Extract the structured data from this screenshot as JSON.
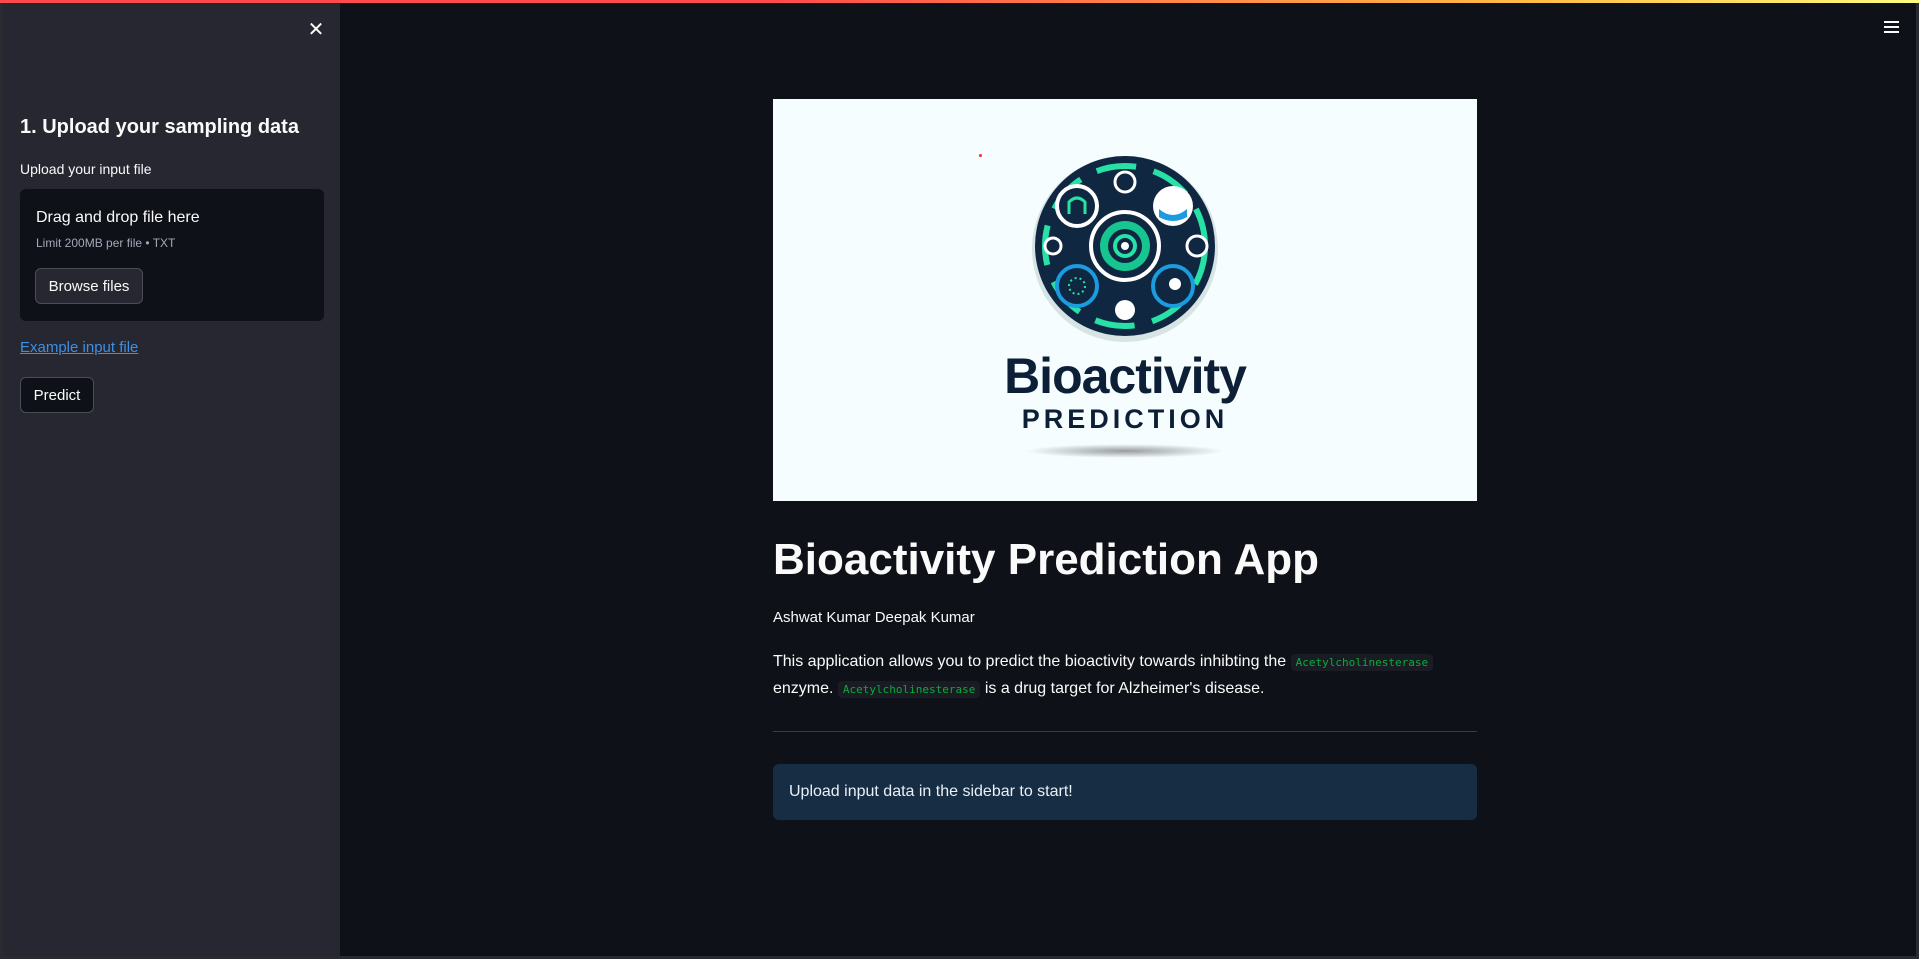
{
  "sidebar": {
    "heading": "1. Upload your sampling data",
    "upload_label": "Upload your input file",
    "dropzone": {
      "title": "Drag and drop file here",
      "limit": "Limit 200MB per file • TXT",
      "browse_label": "Browse files"
    },
    "example_link": "Example input file",
    "predict_label": "Predict"
  },
  "main": {
    "banner": {
      "word1": "Bioactivity",
      "word2": "PREDICTION"
    },
    "title": "Bioactivity Prediction App",
    "author": "Ashwat Kumar Deepak Kumar",
    "desc": {
      "part1": "This application allows you to predict the bioactivity towards inhibting the ",
      "code1": "Acetylcholinesterase",
      "part2": " enzyme. ",
      "code2": "Acetylcholinesterase",
      "part3": " is a drug target for Alzheimer's disease."
    },
    "info": "Upload input data in the sidebar to start!"
  },
  "colors": {
    "background": "#0e1117",
    "sidebar": "#262730",
    "link": "#3d8fe3",
    "info_bg": "#172d43",
    "code_text": "#09ab3b"
  },
  "icons": {
    "close": "close-icon",
    "menu": "hamburger-menu-icon"
  }
}
